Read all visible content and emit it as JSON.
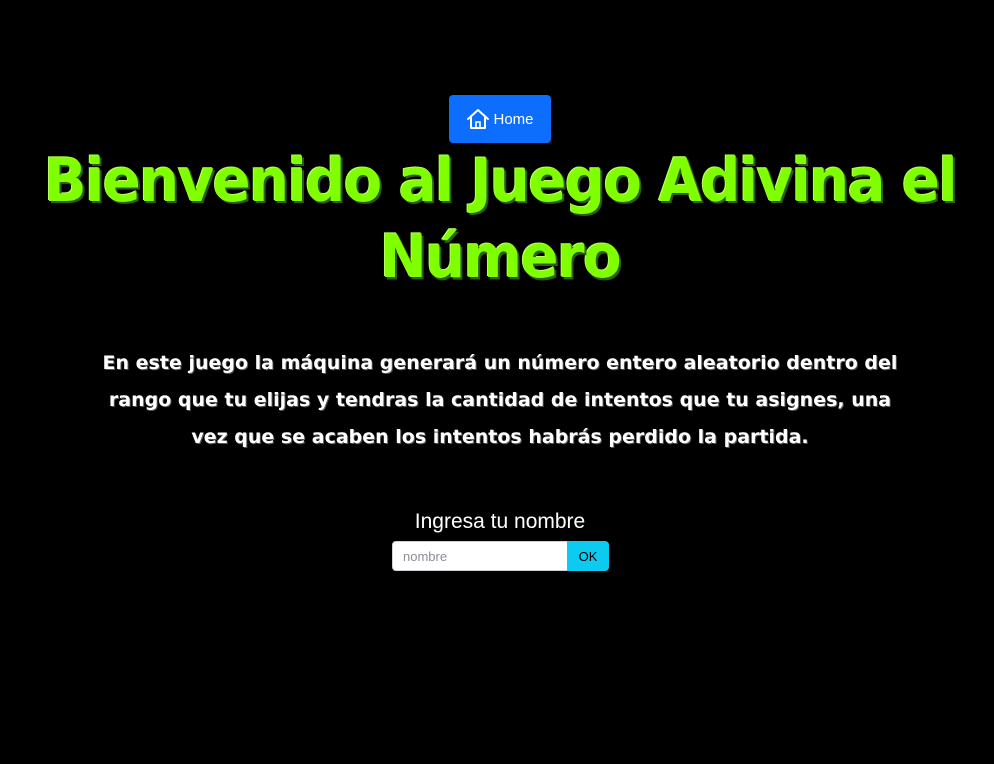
{
  "header": {
    "home_icon": "house-icon",
    "home_label": "Home"
  },
  "main": {
    "title": "Bienvenido al Juego Adivina el Número",
    "description": "En este juego la máquina generará un número entero aleatorio dentro del rango que tu elijas y tendras la cantidad de intentos que tu asignes, una vez que se acaben los intentos habrás perdido la partida."
  },
  "form": {
    "label": "Ingresa tu nombre",
    "name_value": "",
    "name_placeholder": "nombre",
    "ok_label": "OK"
  },
  "colors": {
    "background": "#000000",
    "title": "#7fff00",
    "home_button": "#0d6efd",
    "ok_button": "#0dcaf0"
  }
}
